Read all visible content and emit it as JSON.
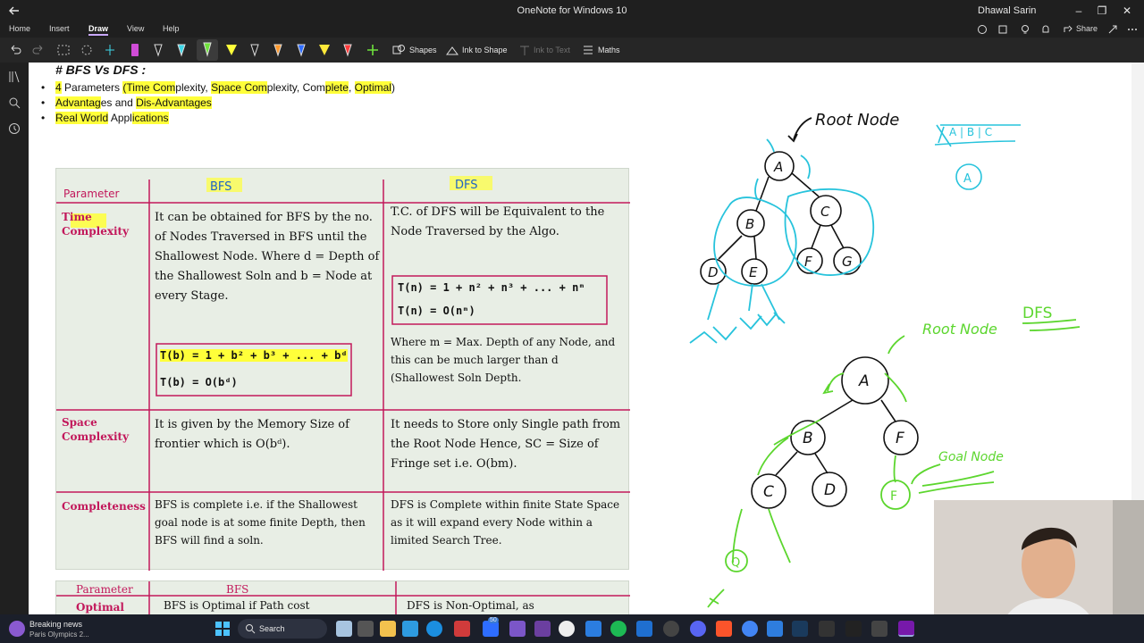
{
  "window": {
    "title": "OneNote for Windows 10",
    "user": "Dhawal Sarin"
  },
  "menu": {
    "items": [
      "Home",
      "Insert",
      "Draw",
      "View",
      "Help"
    ],
    "active": "Draw",
    "share_label": "Share"
  },
  "toolbar": {
    "shapes_label": "Shapes",
    "ink_to_shape_label": "Ink to Shape",
    "ink_to_text_label": "Ink to Text",
    "maths_label": "Maths",
    "pen_colors": [
      "#d04cd7",
      "#222222",
      "#3dd7e8",
      "#6fe23c",
      "#ffff3a",
      "#222222",
      "#ff9a2e",
      "#2e6dff",
      "#ffe93a",
      "#ff3b3b"
    ]
  },
  "page": {
    "heading": "# BFS Vs DFS :",
    "bullets": [
      {
        "parts": [
          [
            "4",
            true
          ],
          [
            " Parameters ",
            false
          ],
          [
            "(Time Com",
            true
          ],
          [
            "plexity, ",
            false
          ],
          [
            "Space Com",
            true
          ],
          [
            "plexity, Com",
            false
          ],
          [
            "plete",
            true
          ],
          [
            ", ",
            false
          ],
          [
            "Optimal",
            true
          ],
          [
            ")",
            false
          ]
        ]
      },
      {
        "parts": [
          [
            "Advantag",
            true
          ],
          [
            "es and ",
            false
          ],
          [
            "Dis-Advantages",
            true
          ]
        ]
      },
      {
        "parts": [
          [
            "Real World",
            true
          ],
          [
            " Appl",
            false
          ],
          [
            "ications",
            true
          ]
        ]
      }
    ]
  },
  "notes": {
    "col_headers": [
      "Parameter",
      "BFS",
      "DFS"
    ],
    "rows": [
      {
        "param": "Time Complexity",
        "bfs": "It can be obtained for BFS by the no. of Nodes Traversed in BFS until the Shallowest Node. Where d = Depth of the Shallowest Soln and b = Node at every Stage.",
        "bfs_formula1": "T(b) = 1 + b² + b³ + ... + bᵈ",
        "bfs_formula2": "T(b) = O(bᵈ)",
        "dfs": "T.C. of DFS will be Equivalent to the Node Traversed by the Algo.",
        "dfs_formula1": "T(n) = 1 + n² + n³ + ... + nᵐ",
        "dfs_formula2": "T(n) = O(nᵐ)",
        "dfs_extra": "Where m = Max. Depth of any Node, and this can be much larger than d (Shallowest Soln Depth."
      },
      {
        "param": "Space Complexity",
        "bfs": "It is given by the Memory Size of frontier which is O(bᵈ).",
        "dfs": "It needs to Store only Single path from the Root Node Hence, SC = Size of Fringe set i.e. O(bm)."
      },
      {
        "param": "Completeness",
        "bfs": "BFS is complete i.e. if the Shallowest goal node is at some finite Depth, then BFS will find a soln.",
        "dfs": "DFS is Complete within finite State Space as it will expand every Node within a limited Search Tree."
      }
    ],
    "row2_headers": [
      "Parameter",
      "BFS"
    ],
    "row2_param": "Optimal",
    "row2_bfs": "BFS is Optimal if Path cost",
    "row2_dfs": "DFS is Non-Optimal, as"
  },
  "ink": {
    "root_node_label": "Root Node",
    "root_node_label2": "Root Node",
    "dfs_label": "DFS",
    "goal_node_label": "Goal Node",
    "queue_label": "A | B | C",
    "bfs_tree_nodes": [
      "A",
      "B",
      "C",
      "D",
      "E",
      "F",
      "G"
    ],
    "dfs_tree_nodes": [
      "A",
      "B",
      "F",
      "C",
      "D",
      "F",
      "Q"
    ]
  },
  "taskbar": {
    "news_title": "Breaking news",
    "news_sub": "Paris Olympics 2...",
    "search_label": "Search",
    "badge": "50"
  }
}
